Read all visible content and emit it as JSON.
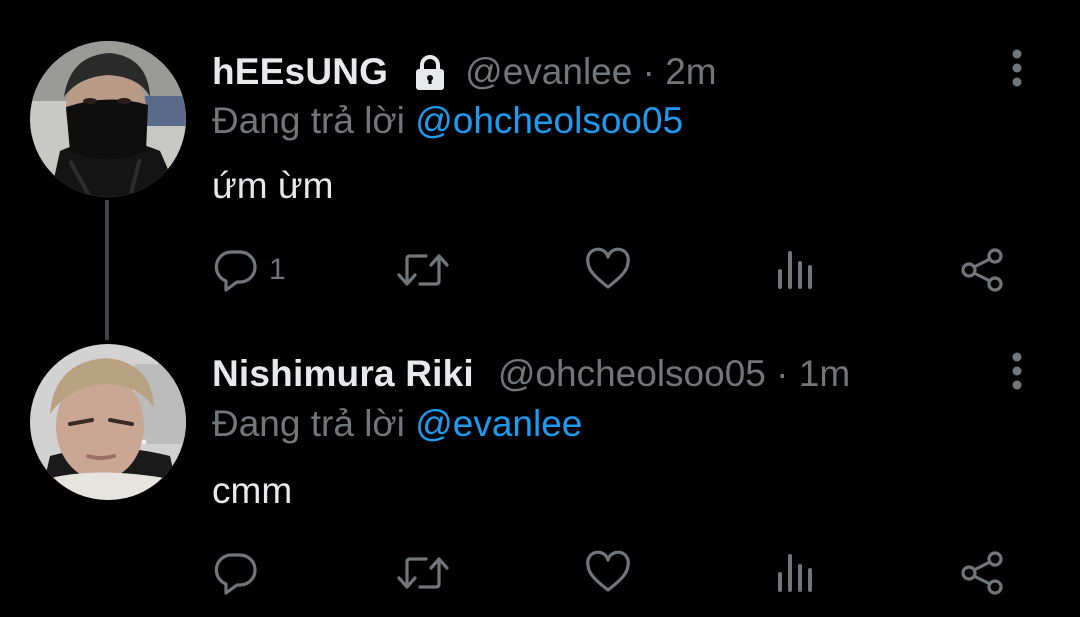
{
  "colors": {
    "background": "#000000",
    "primary_text": "#e7e9ea",
    "secondary_text": "#71767b",
    "link": "#1d9bf0",
    "thread_line": "#3d4349"
  },
  "tweets": [
    {
      "display_name": "hEEsUNG",
      "protected_icon": "lock-icon",
      "handle_time": "@evanlee · 2m",
      "reply_prefix": "Đang trả lời ",
      "reply_to": "@ohcheolsoo05",
      "text": "ứm ừm",
      "reply_count": "1"
    },
    {
      "display_name": "Nishimura Riki",
      "handle_time": "@ohcheolsoo05 · 1m",
      "reply_prefix": "Đang trả lời ",
      "reply_to": "@evanlee",
      "text": "cmm",
      "reply_count": ""
    }
  ]
}
